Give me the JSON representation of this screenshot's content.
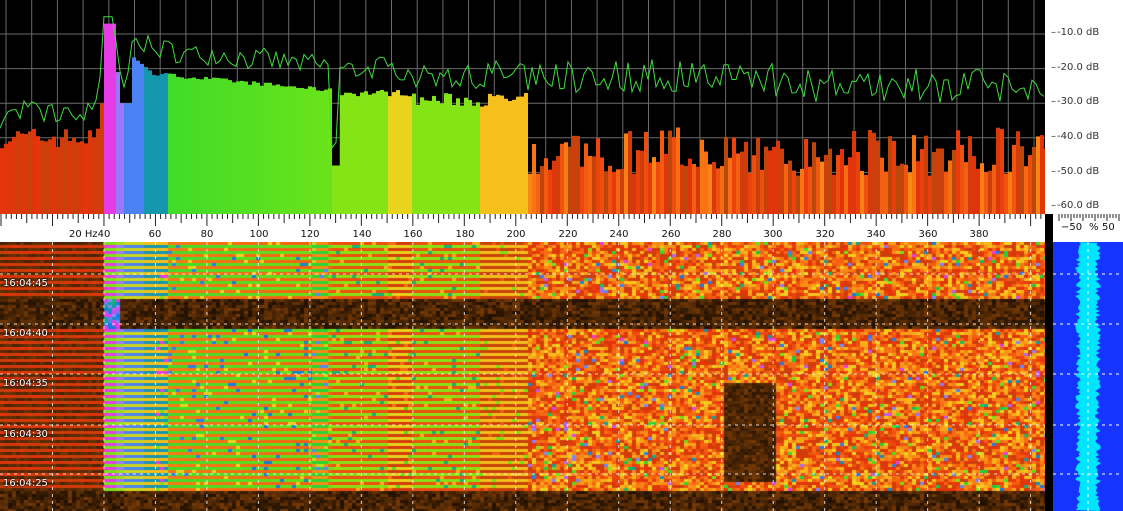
{
  "spectrum": {
    "db_scale": [
      "-10.0 dB",
      "-20.0 dB",
      "-30.0 dB",
      "-40.0 dB",
      "-50.0 dB",
      "-60.0 dB"
    ],
    "peak_trace_color": "#3fdc3f",
    "background_color": "#000000",
    "grid_color": "#6a6a6a"
  },
  "freq_axis": {
    "unit_label": "20 Hz",
    "labels": [
      "40",
      "60",
      "80",
      "100",
      "120",
      "140",
      "160",
      "180",
      "200",
      "220",
      "240",
      "260",
      "280",
      "300",
      "320",
      "340",
      "360",
      "380"
    ]
  },
  "level_meter": {
    "left_label": "−50",
    "mid_label": "%",
    "right_label": "50",
    "bar_color": "#1535ff",
    "level_color": "#00e5ff"
  },
  "waterfall": {
    "time_labels": [
      "16:04:45",
      "16:04:40",
      "16:04:35",
      "16:04:30",
      "16:04:25"
    ]
  }
}
